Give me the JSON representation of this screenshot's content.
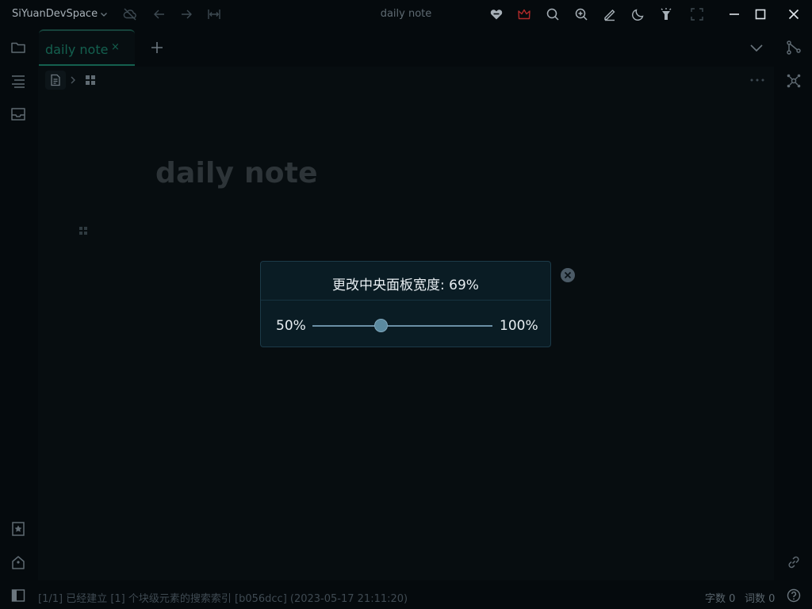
{
  "titlebar": {
    "workspace": "SiYuanDevSpace",
    "window_title": "daily note"
  },
  "tabs": [
    {
      "label": "daily note",
      "close": "×"
    }
  ],
  "editor": {
    "title": "daily note"
  },
  "dialog": {
    "title": "更改中央面板宽度: 69%",
    "min_label": "50%",
    "max_label": "100%",
    "value": 69,
    "min": 50,
    "max": 100
  },
  "statusbar": {
    "message": "[1/1] 已经建立 [1] 个块级元素的搜索索引 [b056dcc] (2023-05-17 21:11:20)",
    "char_count": "字数 0",
    "word_count": "词数 0"
  },
  "colors": {
    "accent": "#14604f",
    "dialog_bg": "#0a1c24",
    "background": "#050a0d"
  }
}
